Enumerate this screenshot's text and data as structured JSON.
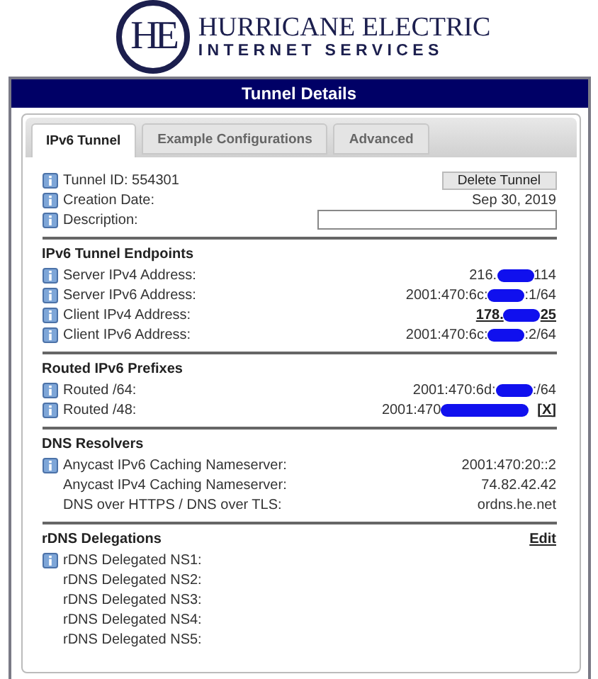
{
  "logo": {
    "monogram": "HE",
    "line1": "HURRICANE ELECTRIC",
    "line2": "INTERNET SERVICES"
  },
  "header": {
    "title": "Tunnel Details"
  },
  "tabs": [
    {
      "label": "IPv6 Tunnel",
      "selected": true
    },
    {
      "label": "Example Configurations",
      "selected": false
    },
    {
      "label": "Advanced",
      "selected": false
    }
  ],
  "sections": [
    {
      "rows": [
        {
          "label": "Tunnel ID: 554301",
          "info": true,
          "value": {
            "kind": "button",
            "text": "Delete Tunnel"
          }
        },
        {
          "label": "Creation Date:",
          "info": true,
          "value": {
            "kind": "text",
            "text": "Sep 30, 2019"
          }
        },
        {
          "label": "Description:",
          "info": true,
          "value": {
            "kind": "input"
          }
        }
      ]
    },
    {
      "title": "IPv6 Tunnel Endpoints",
      "rows": [
        {
          "label": "Server IPv4 Address:",
          "info": true,
          "value": {
            "kind": "masked",
            "before": "216.",
            "after": "114"
          }
        },
        {
          "label": "Server IPv6 Address:",
          "info": true,
          "value": {
            "kind": "masked",
            "before": "2001:470:6c:",
            "after": ":1/64"
          }
        },
        {
          "label": "Client IPv4 Address:",
          "info": true,
          "value": {
            "kind": "masked",
            "before": "178.",
            "after": "25",
            "link": true
          }
        },
        {
          "label": "Client IPv6 Address:",
          "info": true,
          "value": {
            "kind": "masked",
            "before": "2001:470:6c:",
            "after": ":2/64"
          }
        }
      ]
    },
    {
      "title": "Routed IPv6 Prefixes",
      "rows": [
        {
          "label": "Routed /64:",
          "info": true,
          "value": {
            "kind": "masked",
            "before": "2001:470:6d:",
            "after": ":/64"
          }
        },
        {
          "label": "Routed /48:",
          "info": true,
          "value": {
            "kind": "masked",
            "before": "2001:470",
            "remove": "[X]"
          }
        }
      ]
    },
    {
      "title": "DNS Resolvers",
      "rows": [
        {
          "label": "Anycast IPv6 Caching Nameserver:",
          "info": true,
          "value": {
            "kind": "text",
            "text": "2001:470:20::2"
          }
        },
        {
          "label": "Anycast IPv4 Caching Nameserver:",
          "info": false,
          "value": {
            "kind": "text",
            "text": "74.82.42.42"
          }
        },
        {
          "label": "DNS over HTTPS / DNS over TLS:",
          "info": false,
          "value": {
            "kind": "text",
            "text": "ordns.he.net"
          }
        }
      ]
    },
    {
      "title": "rDNS Delegations",
      "action": "Edit",
      "rows": [
        {
          "label": "rDNS Delegated NS1:",
          "info": true
        },
        {
          "label": "rDNS Delegated NS2:",
          "info": false
        },
        {
          "label": "rDNS Delegated NS3:",
          "info": false
        },
        {
          "label": "rDNS Delegated NS4:",
          "info": false
        },
        {
          "label": "rDNS Delegated NS5:",
          "info": false
        }
      ]
    }
  ]
}
